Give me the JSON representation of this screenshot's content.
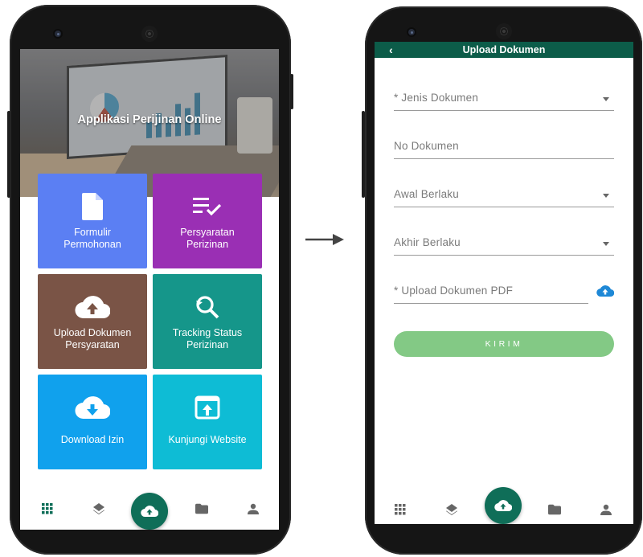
{
  "left_screen": {
    "hero": {
      "title": "Applikasi Perijinan Online"
    },
    "tiles": [
      {
        "line1": "Formulir",
        "line2": "Permohonan",
        "icon": "document-icon",
        "color": "#5b7ff3"
      },
      {
        "line1": "Persyaratan",
        "line2": "Perizinan",
        "icon": "checklist-icon",
        "color": "#9a2fb4"
      },
      {
        "line1": "Upload Dokumen",
        "line2": "Persyaratan",
        "icon": "cloud-upload-icon",
        "color": "#7a5446"
      },
      {
        "line1": "Tracking Status",
        "line2": "Perizinan",
        "icon": "search-refresh-icon",
        "color": "#15968a"
      },
      {
        "line1": "Download Izin",
        "line2": "",
        "icon": "cloud-download-icon",
        "color": "#10a1ed"
      },
      {
        "line1": "Kunjungi Website",
        "line2": "",
        "icon": "open-in-browser-icon",
        "color": "#0ebcd5"
      }
    ],
    "bottom_nav": [
      "grid-icon",
      "layers-icon",
      "cloud-upload-icon",
      "folder-icon",
      "person-icon"
    ],
    "active_nav_color": "#0f6e58"
  },
  "right_screen": {
    "appbar": {
      "back": "‹",
      "title": "Upload Dokumen",
      "color": "#0c5c49"
    },
    "form": {
      "jenis_dokumen": "* Jenis Dokumen",
      "no_dokumen": "No Dokumen",
      "awal_berlaku": "Awal Berlaku",
      "akhir_berlaku": "Akhir Berlaku",
      "upload_pdf": "* Upload Dokumen PDF",
      "submit_label": "KIRIM",
      "submit_color": "#83c985"
    },
    "bottom_nav": [
      "grid-icon",
      "layers-icon",
      "cloud-upload-icon",
      "folder-icon",
      "person-icon"
    ]
  }
}
